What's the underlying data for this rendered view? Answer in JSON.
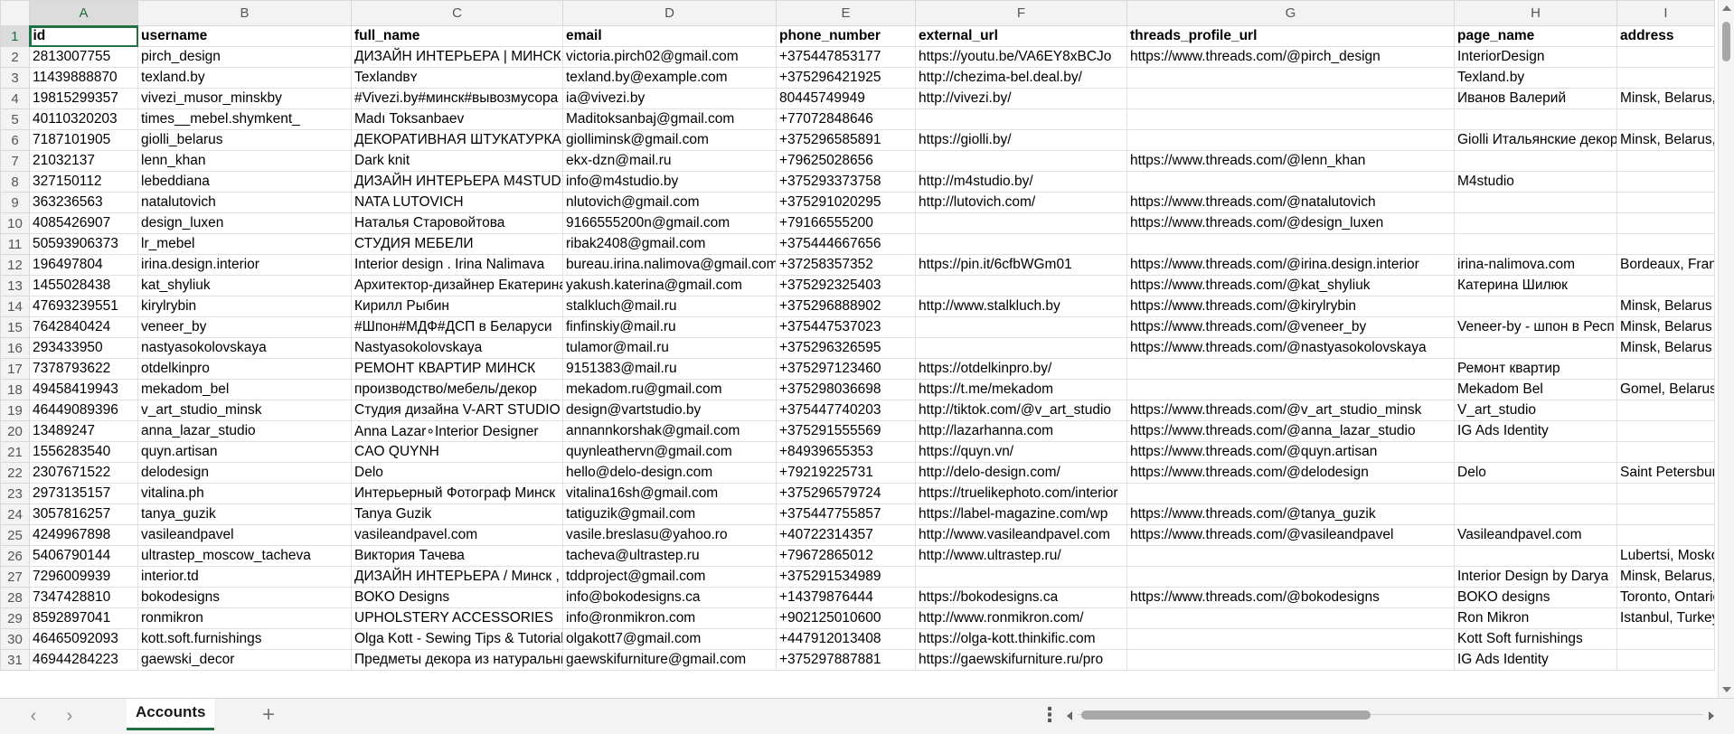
{
  "columns": [
    "A",
    "B",
    "C",
    "D",
    "E",
    "F",
    "G",
    "H",
    "I"
  ],
  "selected_cell": "A1",
  "header": [
    "id",
    "username",
    "full_name",
    "email",
    "phone_number",
    "external_url",
    "threads_profile_url",
    "page_name",
    "address"
  ],
  "rows": [
    [
      "2813007755",
      "pirch_design",
      "ДИЗАЙН ИНТЕРЬЕРА | МИНСК",
      "victoria.pirch02@gmail.com",
      "+375447853177",
      "https://youtu.be/VA6EY8xBCJo",
      "https://www.threads.com/@pirch_design",
      "InteriorDesign",
      ""
    ],
    [
      "11439888870",
      "texland.by",
      "Texlandʙʏ",
      "texland.by@example.com",
      "+375296421925",
      "http://chezima-bel.deal.by/",
      "",
      "Texland.by",
      ""
    ],
    [
      "19815299357",
      "vivezi_musor_minskby",
      "#Vivezi.by#минск#вывозмусора",
      "ia@vivezi.by",
      "80445749949",
      "http://vivezi.by/",
      "",
      "Иванов Валерий",
      "Minsk, Belarus,"
    ],
    [
      "40110320203",
      "times__mebel.shymkent_",
      "Madı Toksanbaev",
      "Maditoksanbaj@gmail.com",
      "+77072848646",
      "",
      "",
      "",
      ""
    ],
    [
      "7187101905",
      "giolli_belarus",
      "ДЕКОРАТИВНАЯ ШТУКАТУРКА",
      "giolliminsk@gmail.com",
      "+375296585891",
      "https://giolli.by/",
      "",
      "Giolli Итальянские декор",
      "Minsk, Belarus,"
    ],
    [
      "21032137",
      "lenn_khan",
      "Dark knit",
      "ekx-dzn@mail.ru",
      "+79625028656",
      "",
      "https://www.threads.com/@lenn_khan",
      "",
      ""
    ],
    [
      "327150112",
      "lebeddiana",
      "ДИЗАЙН ИНТЕРЬЕРА M4STUDIO",
      "info@m4studio.by",
      "+375293373758",
      "http://m4studio.by/",
      "",
      "M4studio",
      ""
    ],
    [
      "363236563",
      "natalutovich",
      "NATA LUTOVICH",
      "nlutovich@gmail.com",
      "+375291020295",
      "http://lutovich.com/",
      "https://www.threads.com/@natalutovich",
      "",
      ""
    ],
    [
      "4085426907",
      "design_luxen",
      "Наталья Старовойтова",
      "9166555200n@gmail.com",
      "+79166555200",
      "",
      "https://www.threads.com/@design_luxen",
      "",
      ""
    ],
    [
      "50593906373",
      "lr_mebel",
      "СТУДИЯ МЕБЕЛИ",
      "ribak2408@gmail.com",
      "+375444667656",
      "",
      "",
      "",
      ""
    ],
    [
      "196497804",
      "irina.design.interior",
      "Interior design . Irina Nalimava",
      "bureau.irina.nalimova@gmail.com",
      "+37258357352",
      "https://pin.it/6cfbWGm01",
      "https://www.threads.com/@irina.design.interior",
      "irina-nalimova.com",
      "Bordeaux, France"
    ],
    [
      "1455028438",
      "kat_shyliuk",
      "Архитектор-дизайнер Екатерина",
      "yakush.katerina@gmail.com",
      "+375292325403",
      "",
      "https://www.threads.com/@kat_shyliuk",
      "Катерина Шилюк",
      ""
    ],
    [
      "47693239551",
      "kirylrybin",
      "Кирилл Рыбин",
      "stalkluch@mail.ru",
      "+375296888902",
      "http://www.stalkluch.by",
      "https://www.threads.com/@kirylrybin",
      "",
      "Minsk, Belarus"
    ],
    [
      "7642840424",
      "veneer_by",
      "#Шпон#МДФ#ДСП в Беларуси",
      "finfinskiy@mail.ru",
      "+375447537023",
      "",
      "https://www.threads.com/@veneer_by",
      "Veneer-by - шпон в Респ",
      "Minsk, Belarus"
    ],
    [
      "293433950",
      "nastyasokolovskaya",
      "Nastyasokolovskaya",
      "tulamor@mail.ru",
      "+375296326595",
      "",
      "https://www.threads.com/@nastyasokolovskaya",
      "",
      "Minsk, Belarus"
    ],
    [
      "7378793622",
      "otdelkinpro",
      "РЕМОНТ КВАРТИР МИНСК",
      "9151383@mail.ru",
      "+375297123460",
      "https://otdelkinpro.by/",
      "",
      "Ремонт квартир",
      ""
    ],
    [
      "49458419943",
      "mekadom_bel",
      "производство/мебель/декор",
      "mekadom.ru@gmail.com",
      "+375298036698",
      "https://t.me/mekadom",
      "",
      "Mekadom Bel",
      "Gomel, Belarus"
    ],
    [
      "46449089396",
      "v_art_studio_minsk",
      "Студия дизайна V-ART STUDIO",
      "design@vartstudio.by",
      "+375447740203",
      "http://tiktok.com/@v_art_studio",
      "https://www.threads.com/@v_art_studio_minsk",
      "V_art_studio",
      ""
    ],
    [
      "13489247",
      "anna_lazar_studio",
      "Anna Lazar∘Interior Designer",
      "annannkorshak@gmail.com",
      "+375291555569",
      "http://lazarhanna.com",
      "https://www.threads.com/@anna_lazar_studio",
      "IG Ads Identity",
      ""
    ],
    [
      "1556283540",
      "quyn.artisan",
      "CAO QUYNH",
      "quynleathervn@gmail.com",
      "+84939655353",
      "https://quyn.vn/",
      "https://www.threads.com/@quyn.artisan",
      "",
      ""
    ],
    [
      "2307671522",
      "delodesign",
      "Delo",
      "hello@delo-design.com",
      "+79219225731",
      "http://delo-design.com/",
      "https://www.threads.com/@delodesign",
      "Delo",
      "Saint Petersburg"
    ],
    [
      "2973135157",
      "vitalina.ph",
      "Интерьерный Фотограф Минск",
      "vitalina16sh@gmail.com",
      "+375296579724",
      "https://truelikephoto.com/interior",
      "",
      "",
      ""
    ],
    [
      "3057816257",
      "tanya_guzik",
      "Tanya Guzik",
      "tatiguzik@gmail.com",
      "+375447755857",
      "https://label-magazine.com/wp",
      "https://www.threads.com/@tanya_guzik",
      "",
      ""
    ],
    [
      "4249967898",
      "vasileandpavel",
      "vasileandpavel.com",
      "vasile.breslasu@yahoo.ro",
      "+40722314357",
      "http://www.vasileandpavel.com",
      "https://www.threads.com/@vasileandpavel",
      "Vasileandpavel.com",
      ""
    ],
    [
      "5406790144",
      "ultrastep_moscow_tacheva",
      "Виктория Тачева",
      "tacheva@ultrastep.ru",
      "+79672865012",
      "http://www.ultrastep.ru/",
      "",
      "",
      "Lubertsi, Moskovskaya"
    ],
    [
      "7296009939",
      "interior.td",
      "ДИЗАЙН ИНТЕРЬЕРА / Минск ,",
      "tddproject@gmail.com",
      "+375291534989",
      "",
      "",
      "Interior Design by Darya",
      "Minsk, Belarus,"
    ],
    [
      "7347428810",
      "bokodesigns",
      "BOKO Designs",
      "info@bokodesigns.ca",
      "+14379876444",
      "https://bokodesigns.ca",
      "https://www.threads.com/@bokodesigns",
      "BOKO designs",
      "Toronto, Ontario"
    ],
    [
      "8592897041",
      "ronmikron",
      "UPHOLSTERY ACCESSORIES",
      "info@ronmikron.com",
      "+902125010600",
      "http://www.ronmikron.com/",
      "",
      "Ron Mikron",
      "Istanbul, Turkey"
    ],
    [
      "46465092093",
      "kott.soft.furnishings",
      "Olga Kott - Sewing Tips & Tutorials",
      "olgakott7@gmail.com",
      "+447912013408",
      "https://olga-kott.thinkific.com",
      "",
      "Kott Soft furnishings",
      ""
    ],
    [
      "46944284223",
      "gaewski_decor",
      "Предметы декора из натуральных",
      "gaewskifurniture@gmail.com",
      "+375297887881",
      "https://gaewskifurniture.ru/pro",
      "",
      "IG Ads Identity",
      ""
    ]
  ],
  "sheet_tabs": [
    "Accounts"
  ],
  "icons": {
    "nav_prev": "‹",
    "nav_next": "›",
    "add_sheet": "+",
    "more": "⋮"
  },
  "colors": {
    "accent": "#217346",
    "header_bg": "#f3f3f3",
    "grid_line": "#e1e1e1"
  }
}
